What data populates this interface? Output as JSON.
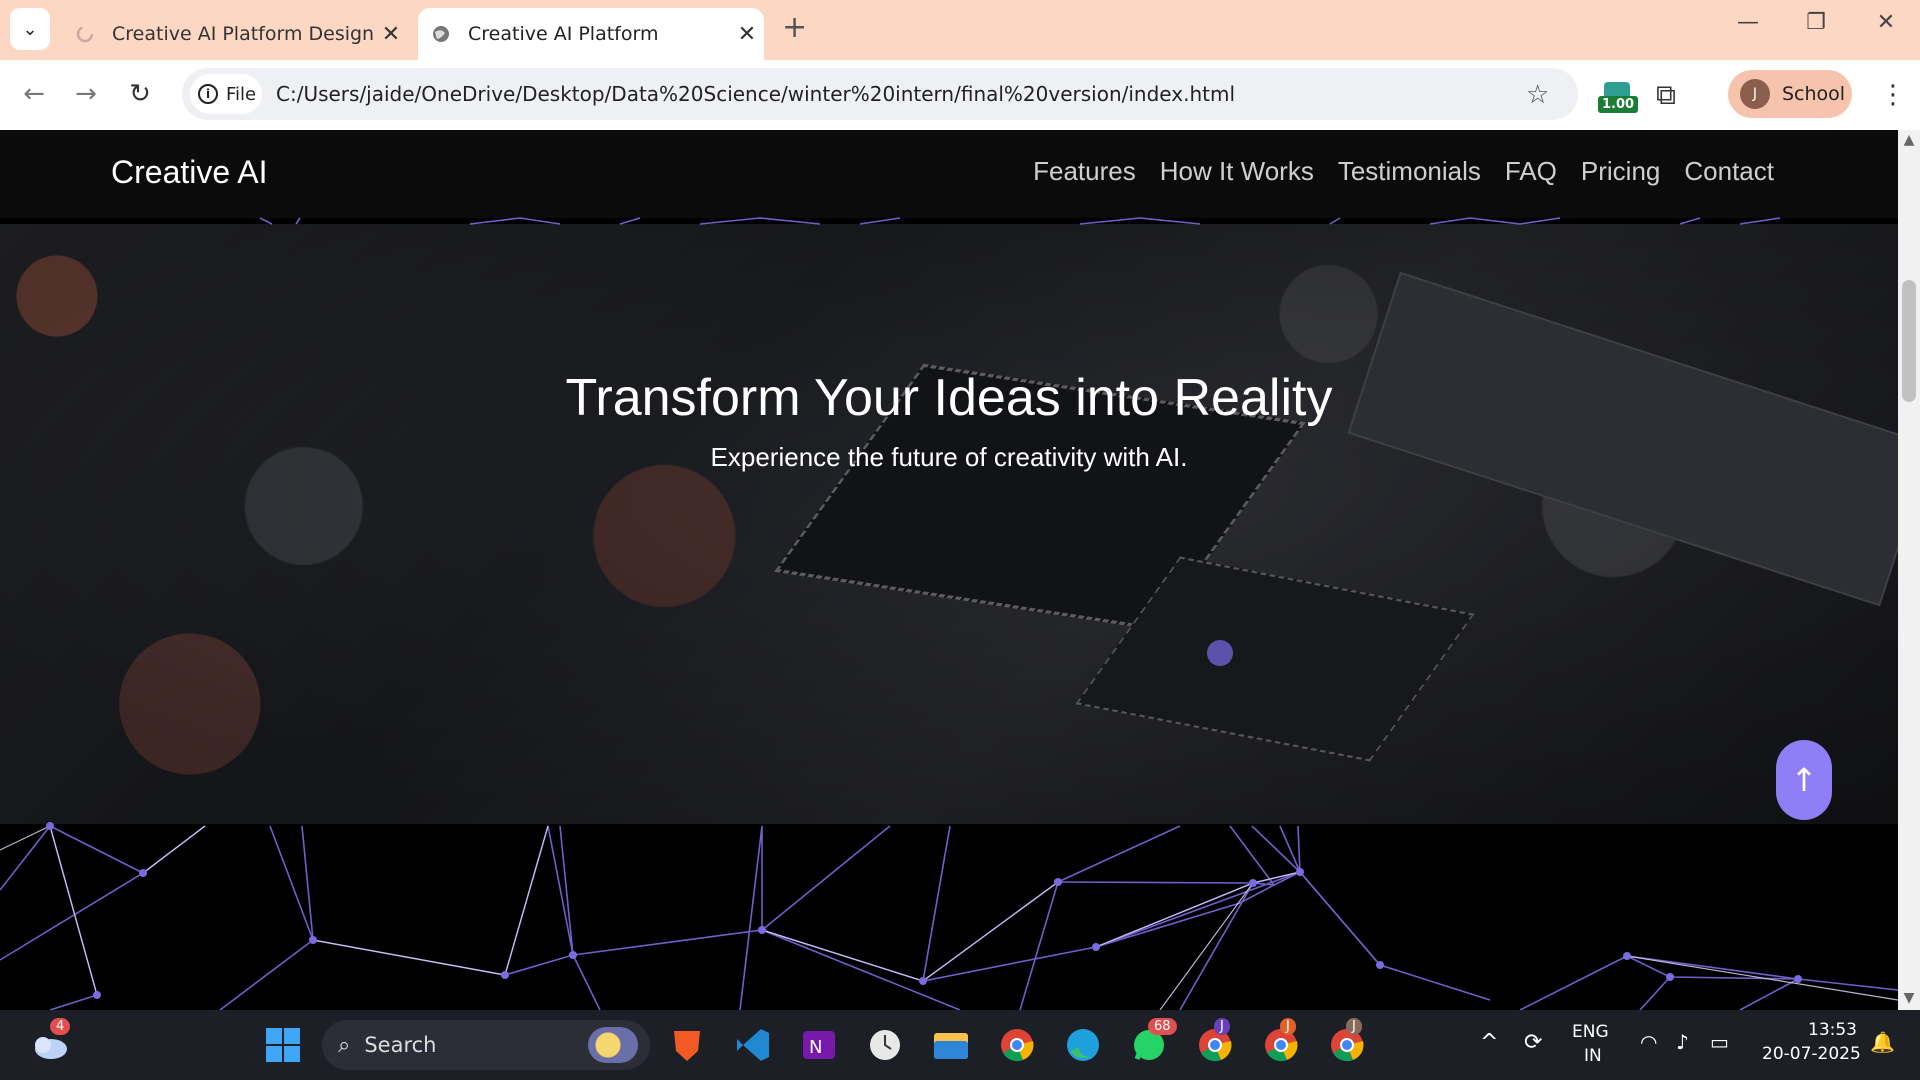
{
  "browser": {
    "tabs": [
      {
        "title": "Creative AI Platform Design - G",
        "active": false
      },
      {
        "title": "Creative AI Platform",
        "active": true
      }
    ],
    "new_tab_icon": "+",
    "file_chip": "File",
    "url": "C:/Users/jaide/OneDrive/Desktop/Data%20Science/winter%20intern/final%20version/index.html",
    "extension_badge": "1.00",
    "profile": {
      "initial": "J",
      "name": "School"
    }
  },
  "site": {
    "logo": "Creative AI",
    "nav": [
      "Features",
      "How It Works",
      "Testimonials",
      "FAQ",
      "Pricing",
      "Contact"
    ],
    "hero_title": "Transform Your Ideas into Reality",
    "hero_subtitle": "Experience the future of creativity with AI.",
    "back_to_top": "↑",
    "colors": {
      "accent": "#8f7ef5",
      "network_line": "#7b6be0",
      "nav_bg": "#0b0b0b"
    }
  },
  "taskbar": {
    "weather_badge": "4",
    "search_placeholder": "Search",
    "whatsapp_badge": "68",
    "chrome_profile_a": "J",
    "chrome_profile_b": "J",
    "chrome_profile_c": "J",
    "language": "ENG",
    "region": "IN",
    "time": "13:53",
    "date": "20-07-2025"
  }
}
